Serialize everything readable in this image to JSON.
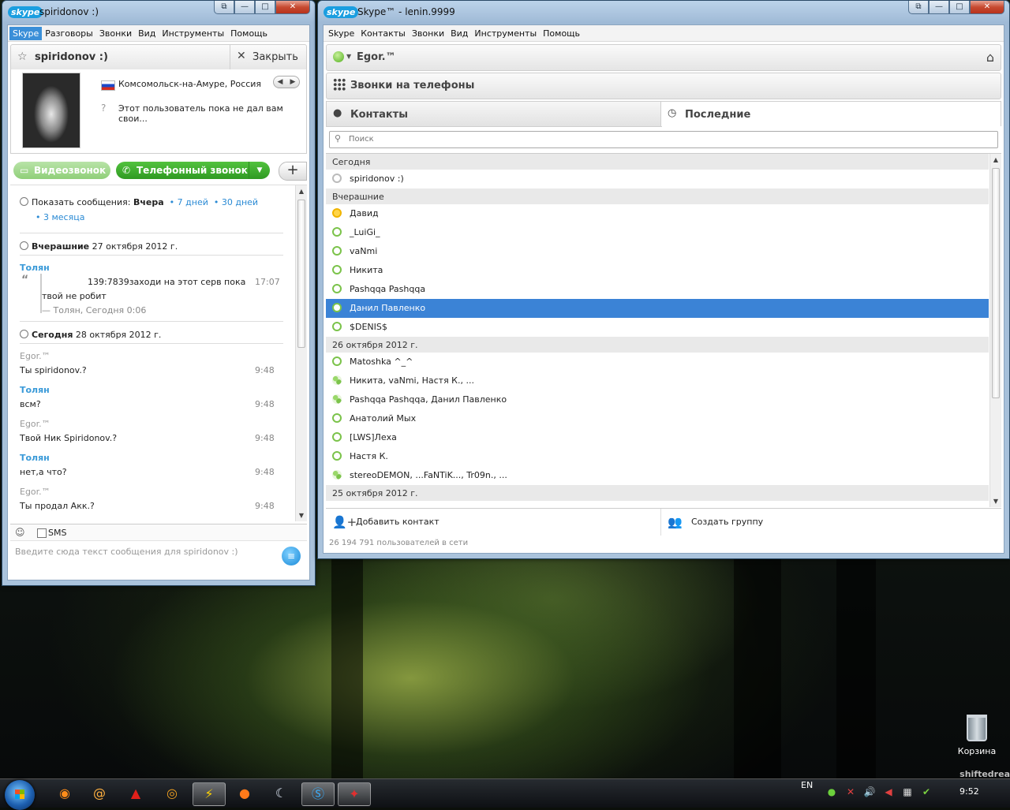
{
  "desktop": {
    "watermark": "shiftedrea",
    "recycle_bin": "Корзина"
  },
  "chat_window": {
    "logo": "skype",
    "title": "spiridonov :)",
    "menu": [
      "Skype",
      "Разговоры",
      "Звонки",
      "Вид",
      "Инструменты",
      "Помощь"
    ],
    "header_name": "spiridonov :)",
    "close_label": "Закрыть",
    "location": "Комсомольск-на-Амуре, Россия",
    "mood": "Этот пользователь пока не дал вам свои...",
    "video_call": "Видеозвонок",
    "phone_call": "Телефонный звонок",
    "history": {
      "label": "Показать сообщения:",
      "current": "Вчера",
      "opt1": "7 дней",
      "opt2": "30 дней",
      "opt3": "3 месяца"
    },
    "day1": {
      "label": "Вчерашние",
      "date": "27 октября 2012 г."
    },
    "quote": {
      "sender": "Толян",
      "text1": "139:7839заходи на этот серв пока",
      "text2": "твой не робит",
      "time": "17:07",
      "attribution": "— Толян, Сегодня 0:06"
    },
    "day2": {
      "label": "Сегодня",
      "date": "28 октября 2012 г."
    },
    "messages": [
      {
        "sender": "Egor.™",
        "text": "Ты spiridonov.?",
        "time": "9:48"
      },
      {
        "sender": "Толян",
        "text": "всм?",
        "time": "9:48"
      },
      {
        "sender": "Egor.™",
        "text": "Твой Ник Spiridonov.?",
        "time": "9:48"
      },
      {
        "sender": "Толян",
        "text": "нет,а что?",
        "time": "9:48"
      },
      {
        "sender": "Egor.™",
        "text": "Ты продал Акк.?",
        "time": "9:48"
      }
    ],
    "sms_label": "SMS",
    "input_placeholder": "Введите сюда текст сообщения для spiridonov :)"
  },
  "main_window": {
    "logo": "skype",
    "title": "Skype™ - lenin.9999",
    "menu": [
      "Skype",
      "Контакты",
      "Звонки",
      "Вид",
      "Инструменты",
      "Помощь"
    ],
    "user_name": "Egor.™",
    "phones_label": "Звонки на телефоны",
    "tab_contacts": "Контакты",
    "tab_recent": "Последние",
    "search_placeholder": "Поиск",
    "list": [
      {
        "type": "group",
        "label": "Сегодня"
      },
      {
        "type": "item",
        "name": "spiridonov :)",
        "status": "off"
      },
      {
        "type": "group",
        "label": "Вчерашние"
      },
      {
        "type": "item",
        "name": "Давид",
        "status": "away"
      },
      {
        "type": "item",
        "name": "_LuiGi_",
        "status": "online"
      },
      {
        "type": "item",
        "name": "vaNmi",
        "status": "online"
      },
      {
        "type": "item",
        "name": "Никита",
        "status": "online"
      },
      {
        "type": "item",
        "name": "Pashqqa Pashqqa",
        "status": "online"
      },
      {
        "type": "item",
        "name": "Данил Павленко",
        "status": "online",
        "selected": true
      },
      {
        "type": "item",
        "name": "$DENIS$",
        "status": "online"
      },
      {
        "type": "group",
        "label": "26 октября 2012 г."
      },
      {
        "type": "item",
        "name": "Matoshka ^_^",
        "status": "online"
      },
      {
        "type": "item",
        "name": "Никита, vaNmi, Настя К., ...",
        "status": "multi"
      },
      {
        "type": "item",
        "name": "Pashqqa Pashqqa, Данил Павленко",
        "status": "multi"
      },
      {
        "type": "item",
        "name": "Анатолий Мых",
        "status": "online"
      },
      {
        "type": "item",
        "name": "[LWS]Леха",
        "status": "online"
      },
      {
        "type": "item",
        "name": "Настя К.",
        "status": "online"
      },
      {
        "type": "item",
        "name": "stereoDEMON, ...FaNTiK..., Tr09n., ...",
        "status": "multi"
      },
      {
        "type": "group",
        "label": "25 октября 2012 г."
      }
    ],
    "add_contact": "Добавить контакт",
    "create_group": "Создать группу",
    "users_online": "26 194 791 пользователей в сети"
  },
  "taskbar": {
    "apps": [
      "browser-icon",
      "mail-icon",
      "acrobat-icon",
      "chrome-icon",
      "winamp-icon",
      "firefox-icon",
      "steam-icon",
      "skype-icon",
      "game-icon"
    ],
    "lang": "EN",
    "clock": "9:52"
  }
}
